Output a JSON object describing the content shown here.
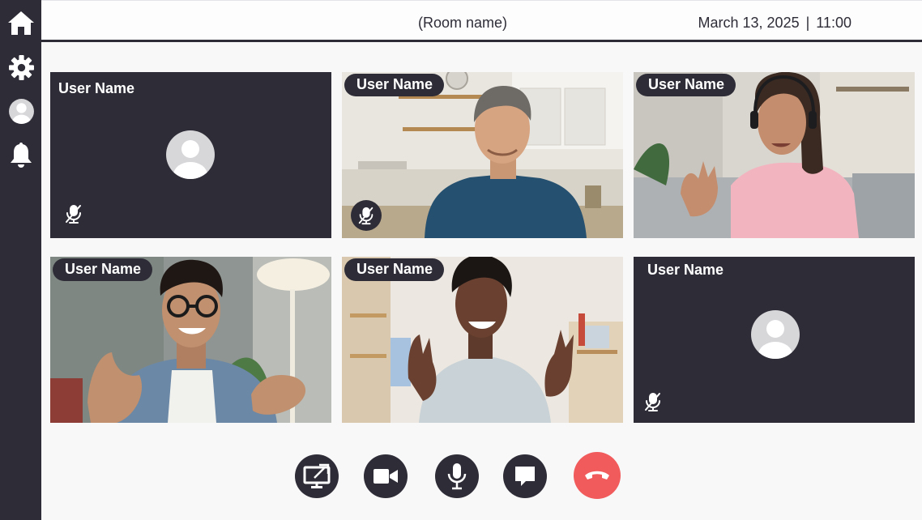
{
  "header": {
    "room_name": "(Room name)",
    "date": "March 13, 2025",
    "separator": "|",
    "time": "11:00"
  },
  "sidebar": {
    "items": [
      {
        "icon": "home-icon"
      },
      {
        "icon": "gear-icon"
      },
      {
        "icon": "user-icon"
      },
      {
        "icon": "bell-icon"
      }
    ]
  },
  "participants": [
    {
      "name": "User Name",
      "video": false,
      "muted": true
    },
    {
      "name": "User Name",
      "video": true,
      "muted": true
    },
    {
      "name": "User Name",
      "video": true,
      "muted": false
    },
    {
      "name": "User Name",
      "video": true,
      "muted": false
    },
    {
      "name": "User Name",
      "video": true,
      "muted": false
    },
    {
      "name": "User Name",
      "video": false,
      "muted": true
    }
  ],
  "controls": [
    {
      "icon": "screen-share-icon"
    },
    {
      "icon": "video-camera-icon"
    },
    {
      "icon": "microphone-icon"
    },
    {
      "icon": "chat-icon"
    },
    {
      "icon": "end-call-icon"
    }
  ],
  "colors": {
    "sidebar": "#2e2d37",
    "background": "#f8f8f9",
    "end_call": "#f15b5b",
    "avatar": "#d7d7da"
  }
}
